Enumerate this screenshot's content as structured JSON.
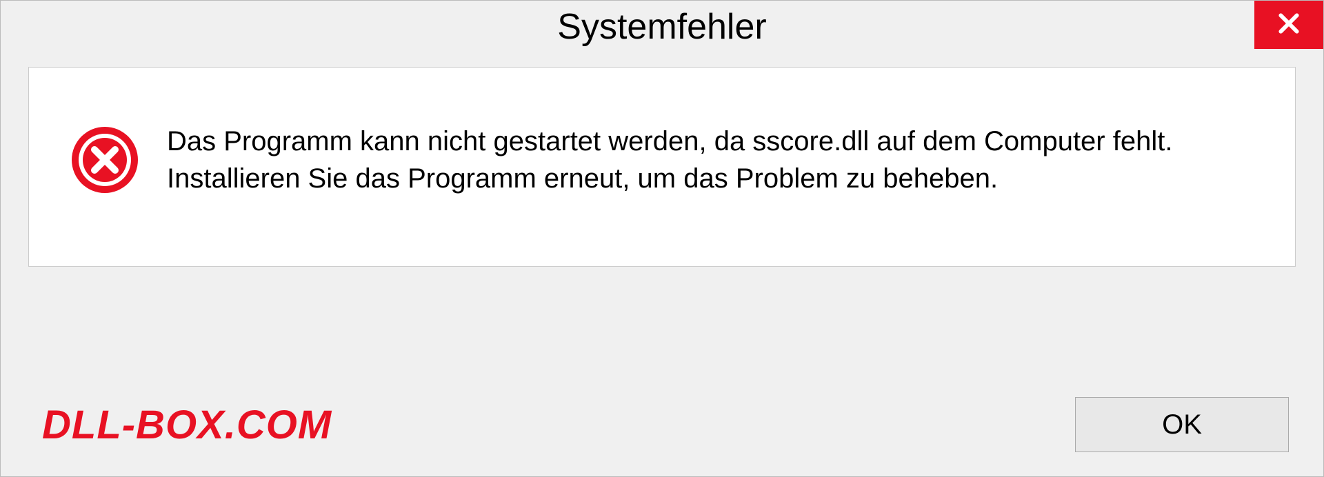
{
  "dialog": {
    "title": "Systemfehler",
    "message": "Das Programm kann nicht gestartet werden, da sscore.dll auf dem Computer fehlt. Installieren Sie das Programm erneut, um das Problem zu beheben.",
    "ok_label": "OK"
  },
  "watermark": "DLL-BOX.COM",
  "icons": {
    "close": "close-icon",
    "error": "error-icon"
  },
  "colors": {
    "accent_red": "#e81123",
    "background": "#f0f0f0",
    "content_bg": "#ffffff"
  }
}
